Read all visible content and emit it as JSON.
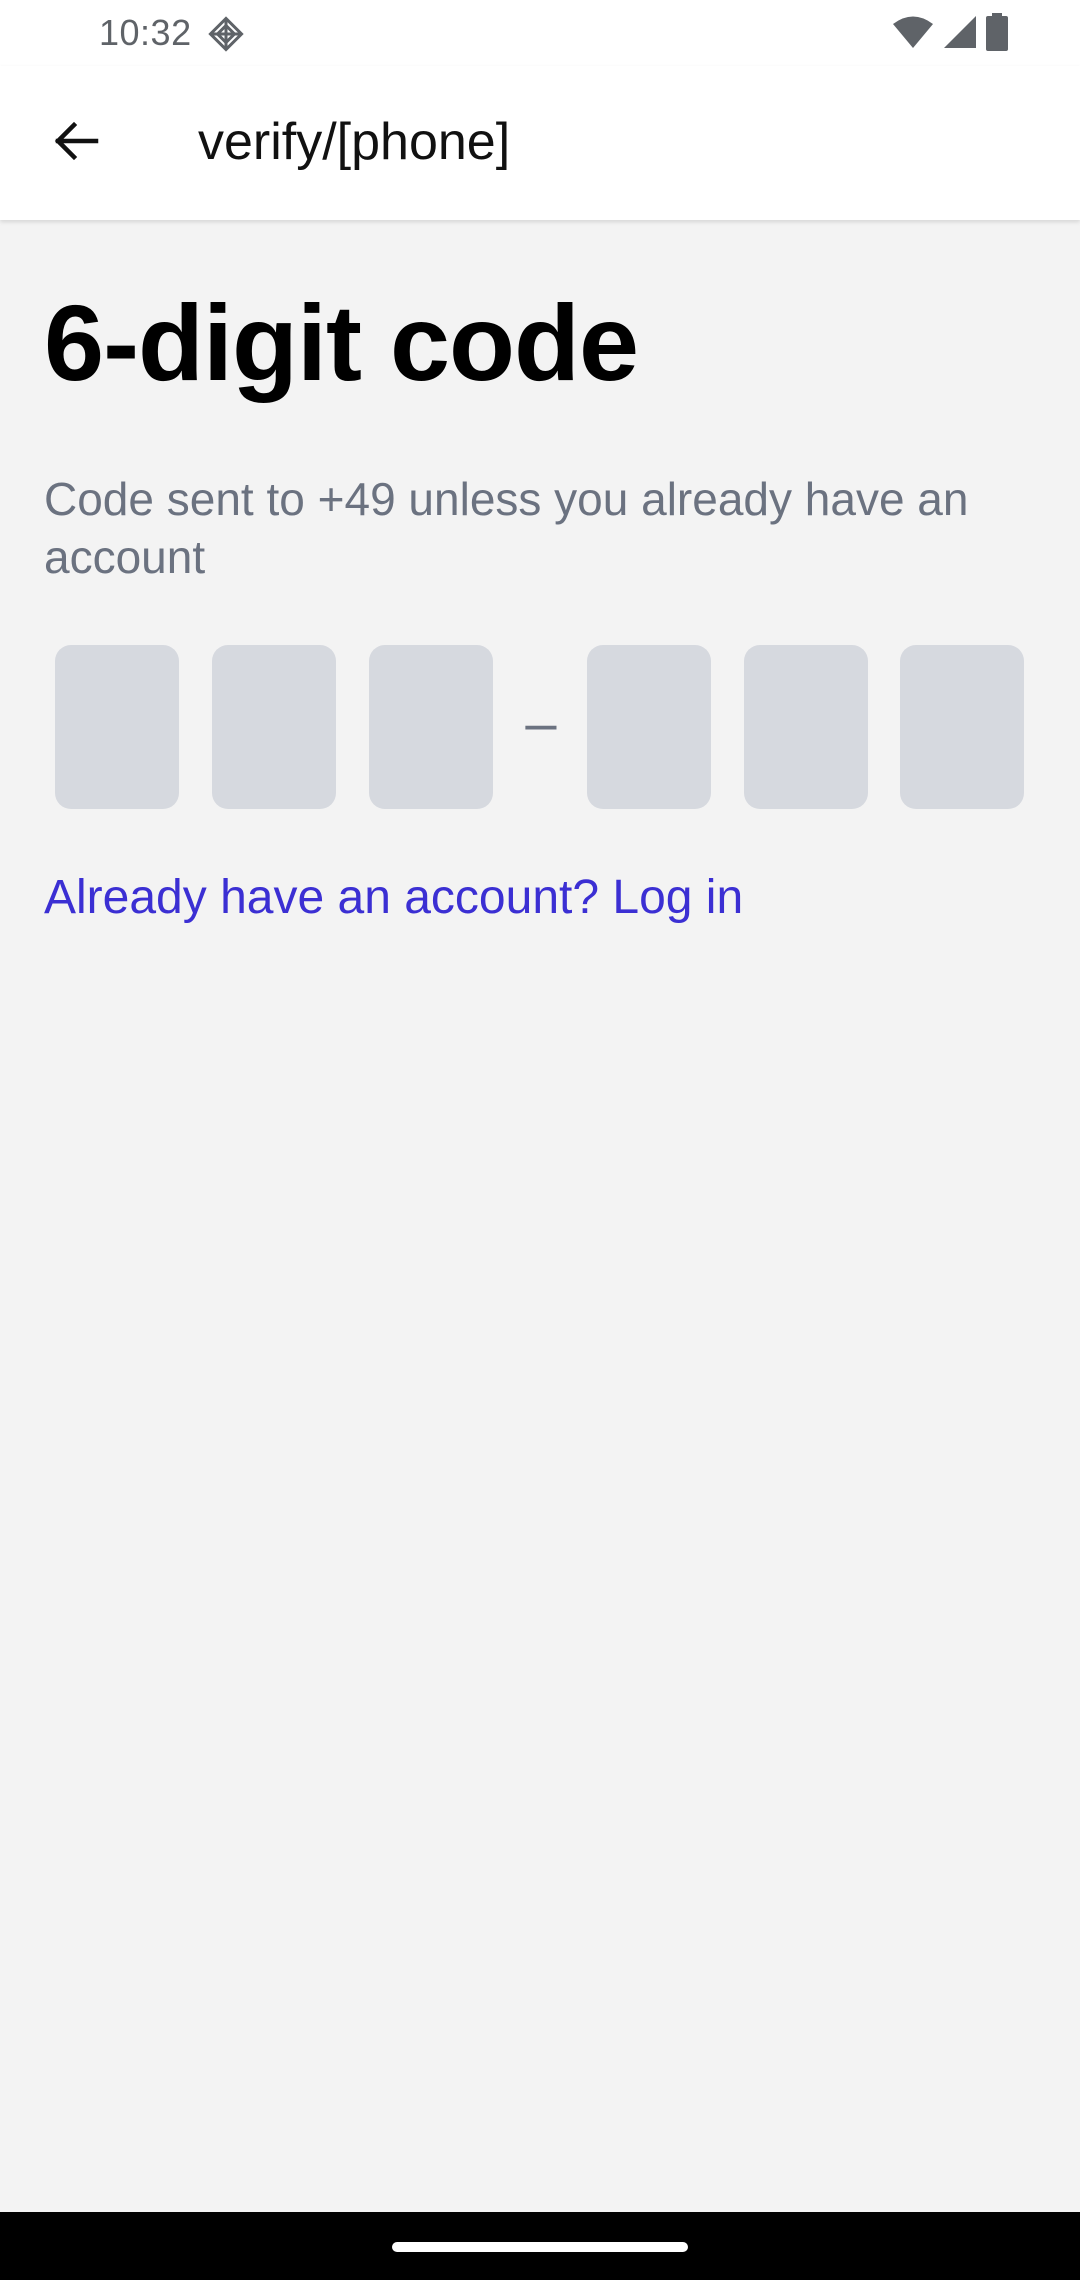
{
  "status_bar": {
    "time": "10:32",
    "icons": [
      "app-notification-icon",
      "wifi-icon",
      "cellular-signal-icon",
      "battery-icon"
    ]
  },
  "app_bar": {
    "back_icon": "arrow-left-icon",
    "title": "verify/[phone]"
  },
  "main": {
    "title": "6-digit code",
    "description": "Code sent to +49 unless you already have an account",
    "code": {
      "digits": [
        "",
        "",
        "",
        "",
        "",
        ""
      ],
      "separator": "–"
    },
    "login_link": "Already have an account? Log in"
  },
  "colors": {
    "background": "#f3f3f3",
    "code_box": "#d6d9df",
    "link": "#3b2fd3",
    "description": "#6b7280"
  }
}
